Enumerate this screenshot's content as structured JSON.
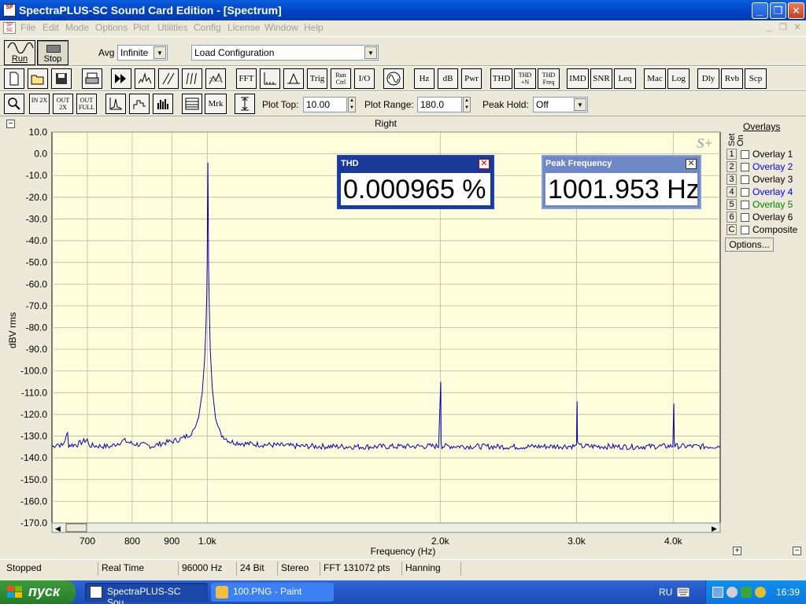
{
  "window": {
    "title": "SpectraPLUS-SC Sound Card Edition - [Spectrum]",
    "app_icon_text": "SP"
  },
  "menu": [
    "File",
    "Edit",
    "Mode",
    "Options",
    "Plot",
    "Utilities",
    "Config",
    "License",
    "Window",
    "Help"
  ],
  "toolbar1": {
    "run_label": "Run",
    "stop_label": "Stop",
    "avg_label": "Avg",
    "avg_value": "Infinite",
    "config_value": "Load Configuration"
  },
  "toolbar2": {
    "buttons": [
      "FFT",
      "Trig",
      "Run Ctrl",
      "I/O",
      "Hz",
      "dB",
      "Pwr",
      "THD",
      "THD +N",
      "THD Freq",
      "IMD",
      "SNR",
      "Leq",
      "Mac",
      "Log",
      "Dly",
      "Rvb",
      "Scp"
    ]
  },
  "toolbar3": {
    "zoom_in": "IN 2X",
    "zoom_out": "OUT 2X",
    "zoom_full": "OUT FULL",
    "mrk_label": "Mrk",
    "plot_top_label": "Plot Top:",
    "plot_top_value": "10.00",
    "plot_range_label": "Plot Range:",
    "plot_range_value": "180.0",
    "peak_hold_label": "Peak Hold:",
    "peak_hold_value": "Off"
  },
  "overlays": {
    "title": "Overlays",
    "set_header": "Set",
    "on_header": "On",
    "items": [
      {
        "set": "1",
        "name": "Overlay 1",
        "color": "#000000"
      },
      {
        "set": "2",
        "name": "Overlay 2",
        "color": "#0000ff"
      },
      {
        "set": "3",
        "name": "Overlay 3",
        "color": "#000000"
      },
      {
        "set": "4",
        "name": "Overlay 4",
        "color": "#0000ff"
      },
      {
        "set": "5",
        "name": "Overlay 5",
        "color": "#008000"
      },
      {
        "set": "6",
        "name": "Overlay 6",
        "color": "#000000"
      },
      {
        "set": "C",
        "name": "Composite",
        "color": "#000000"
      }
    ],
    "options_label": "Options..."
  },
  "meters": {
    "thd": {
      "title": "THD",
      "value": "0.000965 %"
    },
    "peak": {
      "title": "Peak Frequency",
      "value": "1001.953 Hz"
    }
  },
  "status": [
    "Stopped",
    "Real Time",
    "96000 Hz",
    "24 Bit",
    "Stereo",
    "FFT 131072 pts",
    "Hanning"
  ],
  "taskbar": {
    "start_label": "пуск",
    "tasks": [
      "SpectraPLUS-SC Sou...",
      "100.PNG - Paint"
    ],
    "lang": "RU",
    "clock": "16:39"
  },
  "chart_data": {
    "type": "line",
    "title": "Right",
    "watermark": "S+",
    "xlabel": "Frequency (Hz)",
    "ylabel": "dBV rms",
    "x_scale": "log",
    "xlim": [
      630,
      4600
    ],
    "ylim": [
      -170,
      10
    ],
    "grid": true,
    "x_ticks": [
      700,
      800,
      900,
      1000,
      2000,
      3000,
      4000
    ],
    "x_tick_labels": [
      "700",
      "800",
      "900",
      "1.0k",
      "2.0k",
      "3.0k",
      "4.0k"
    ],
    "y_ticks": [
      10,
      0,
      -10,
      -20,
      -30,
      -40,
      -50,
      -60,
      -70,
      -80,
      -90,
      -100,
      -110,
      -120,
      -130,
      -140,
      -150,
      -160,
      -170
    ],
    "y_tick_labels": [
      "10.0",
      "0.0",
      "-10.0",
      "-20.0",
      "-30.0",
      "-40.0",
      "-50.0",
      "-60.0",
      "-70.0",
      "-80.0",
      "-90.0",
      "-100.0",
      "-110.0",
      "-120.0",
      "-130.0",
      "-140.0",
      "-150.0",
      "-160.0",
      "-170.0"
    ],
    "series": [
      {
        "color": "#0000b0",
        "noise_floor": -134.5,
        "points": [
          [
            630,
            -135
          ],
          [
            640,
            -133.5
          ],
          [
            650,
            -134.5
          ],
          [
            660,
            -128.8
          ],
          [
            662,
            -134.2
          ],
          [
            680,
            -133.8
          ],
          [
            700,
            -131.5
          ],
          [
            703,
            -134.3
          ],
          [
            750,
            -134.8
          ],
          [
            780,
            -132.0
          ],
          [
            800,
            -133.5
          ],
          [
            850,
            -134.6
          ],
          [
            880,
            -133.0
          ],
          [
            900,
            -132.5
          ],
          [
            930,
            -131.0
          ],
          [
            950,
            -129.0
          ],
          [
            965,
            -126.0
          ],
          [
            975,
            -121.0
          ],
          [
            985,
            -110.0
          ],
          [
            992,
            -95.0
          ],
          [
            996,
            -80.0
          ],
          [
            998.5,
            -65.0
          ],
          [
            1000,
            -48.0
          ],
          [
            1001,
            -25.0
          ],
          [
            1001.95,
            -4.0
          ],
          [
            1003,
            -28.0
          ],
          [
            1004,
            -52.0
          ],
          [
            1006,
            -70.0
          ],
          [
            1009,
            -90.0
          ],
          [
            1015,
            -108.0
          ],
          [
            1025,
            -122.0
          ],
          [
            1040,
            -129.0
          ],
          [
            1070,
            -132.5
          ],
          [
            1120,
            -133.5
          ],
          [
            1300,
            -134.6
          ],
          [
            1600,
            -134.9
          ],
          [
            1990,
            -134.6
          ],
          [
            2003,
            -105.0
          ],
          [
            2005,
            -132.0
          ],
          [
            2010,
            -134.6
          ],
          [
            2500,
            -134.9
          ],
          [
            3000,
            -134.6
          ],
          [
            3005,
            -114.0
          ],
          [
            3009,
            -131.5
          ],
          [
            3020,
            -134.6
          ],
          [
            3500,
            -134.9
          ],
          [
            3995,
            -134.6
          ],
          [
            4007,
            -115.0
          ],
          [
            4012,
            -132.0
          ],
          [
            4020,
            -134.6
          ],
          [
            4400,
            -134.8
          ],
          [
            4600,
            -134.6
          ]
        ]
      }
    ]
  }
}
